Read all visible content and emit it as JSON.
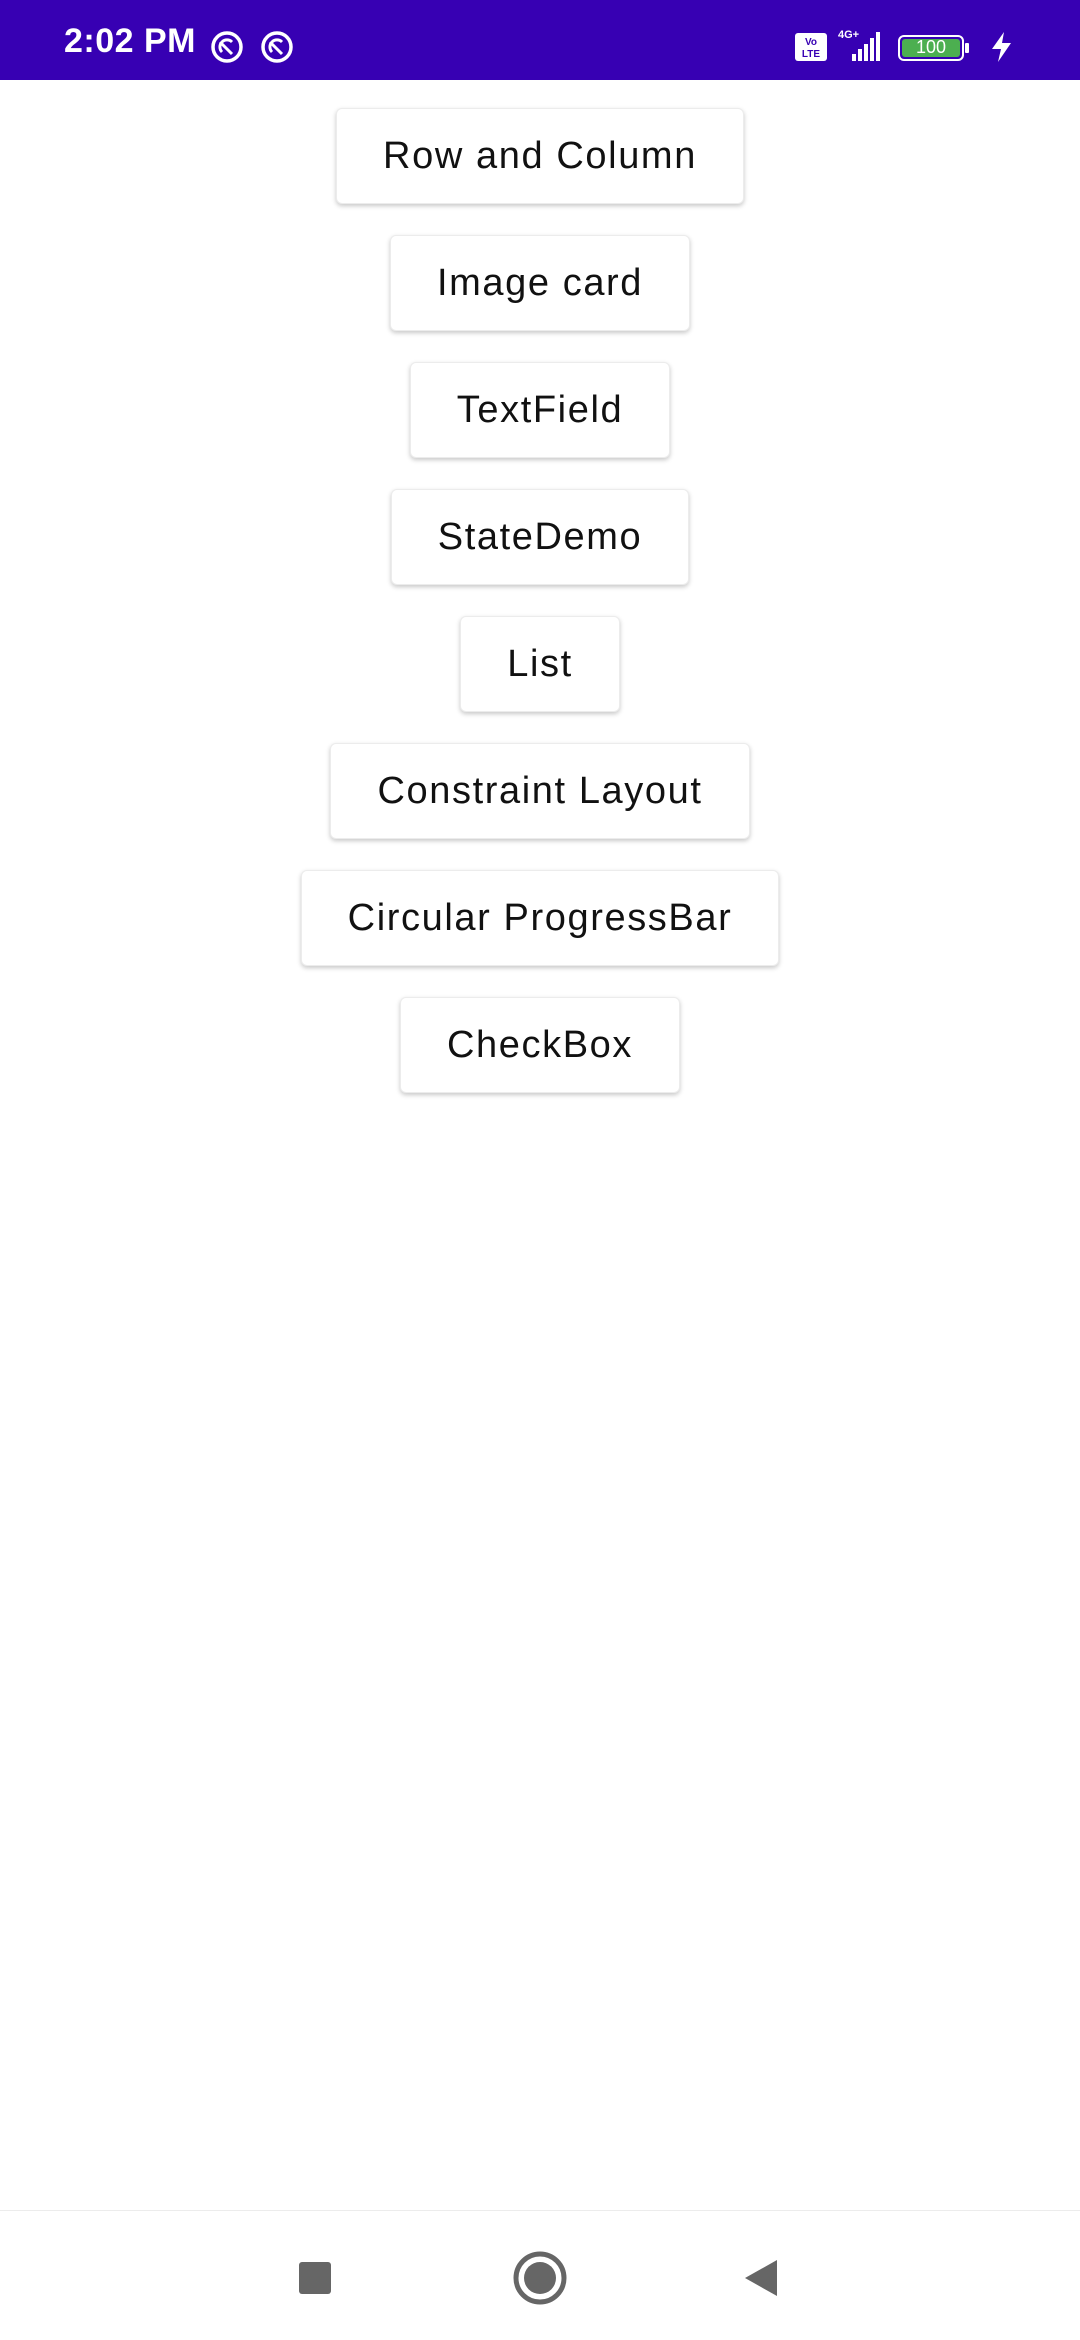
{
  "status_bar": {
    "time": "2:02 PM",
    "network_label": "4G+",
    "volte_label": "Vo LTE",
    "battery_level": "100",
    "background": "#3700B3",
    "icons": [
      "sync-icon",
      "sync-icon",
      "volte-icon",
      "signal-icon",
      "battery-icon",
      "charging-icon"
    ]
  },
  "buttons": [
    {
      "label": "Row and Column"
    },
    {
      "label": "Image card"
    },
    {
      "label": "TextField"
    },
    {
      "label": "StateDemo"
    },
    {
      "label": "List"
    },
    {
      "label": "Constraint Layout"
    },
    {
      "label": "Circular ProgressBar"
    },
    {
      "label": "CheckBox"
    }
  ],
  "nav_bar": {
    "icons": [
      "recents-square-icon",
      "home-circle-icon",
      "back-triangle-icon"
    ]
  }
}
